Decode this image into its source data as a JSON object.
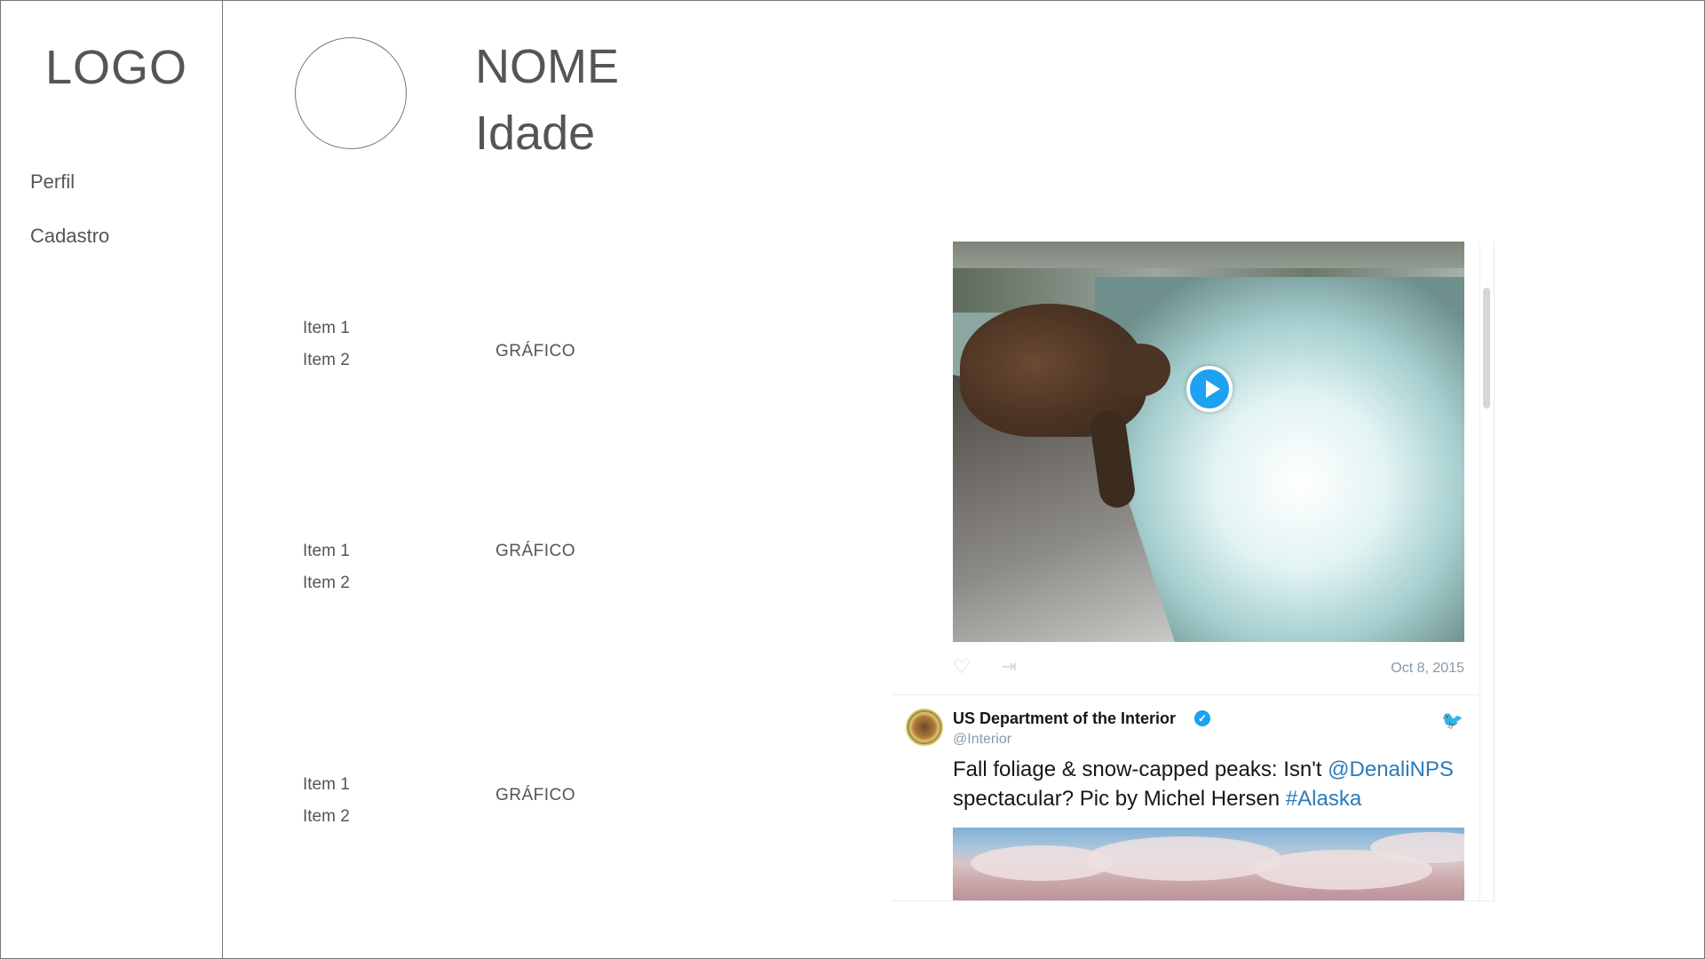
{
  "sidebar": {
    "logo": "LOGO",
    "items": [
      {
        "label": "Perfil"
      },
      {
        "label": "Cadastro"
      }
    ]
  },
  "profile": {
    "name": "NOME",
    "age": "Idade"
  },
  "sections": [
    {
      "items": [
        "Item 1",
        "Item 2"
      ],
      "chart_label": "GRÁFICO"
    },
    {
      "items": [
        "Item 1",
        "Item 2"
      ],
      "chart_label": "GRÁFICO"
    },
    {
      "items": [
        "Item 1",
        "Item 2"
      ],
      "chart_label": "GRÁFICO"
    }
  ],
  "tweet_embed": {
    "first": {
      "date": "Oct 8, 2015",
      "icons": [
        "heart-icon",
        "share-icon",
        "play-icon"
      ]
    },
    "second": {
      "name": "US Department of the Interior",
      "handle": "@Interior",
      "text_before": "Fall foliage & snow-capped peaks: Isn't ",
      "mention": "@DenaliNPS",
      "text_middle": " spectacular? Pic by Michel Hersen ",
      "hashtag": "#Alaska",
      "icons": [
        "verified-icon",
        "bird-icon"
      ]
    },
    "colors": {
      "accent": "#1da1f2",
      "link": "#2b7bb9",
      "muted": "#8899a6"
    }
  }
}
